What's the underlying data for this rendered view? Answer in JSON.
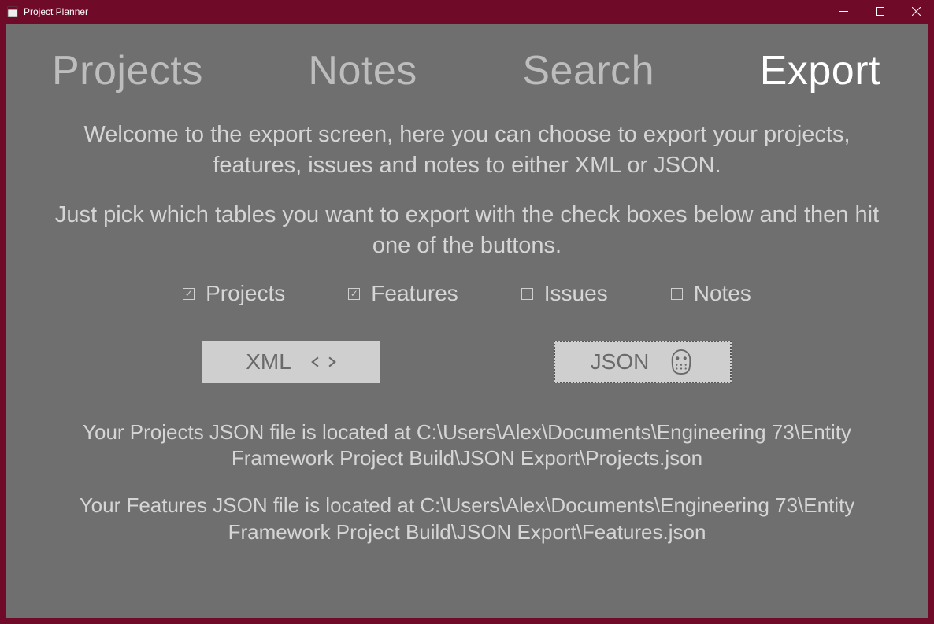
{
  "window": {
    "title": "Project Planner"
  },
  "tabs": {
    "projects": "Projects",
    "notes": "Notes",
    "search": "Search",
    "export": "Export",
    "active": "export"
  },
  "intro": {
    "line1": "Welcome to the export screen, here you can choose to export your projects, features, issues and notes to either XML or JSON.",
    "line2": "Just pick which tables you want to export with the check boxes below and then hit one of the buttons."
  },
  "checkboxes": {
    "projects": {
      "label": "Projects",
      "checked": true
    },
    "features": {
      "label": "Features",
      "checked": true
    },
    "issues": {
      "label": "Issues",
      "checked": false
    },
    "notes": {
      "label": "Notes",
      "checked": false
    }
  },
  "buttons": {
    "xml": "XML",
    "json": "JSON"
  },
  "messages": {
    "m1": "Your Projects JSON file is located at C:\\Users\\Alex\\Documents\\Engineering 73\\Entity Framework Project Build\\JSON Export\\Projects.json",
    "m2": "Your Features JSON file is located at C:\\Users\\Alex\\Documents\\Engineering 73\\Entity Framework Project Build\\JSON Export\\Features.json"
  }
}
